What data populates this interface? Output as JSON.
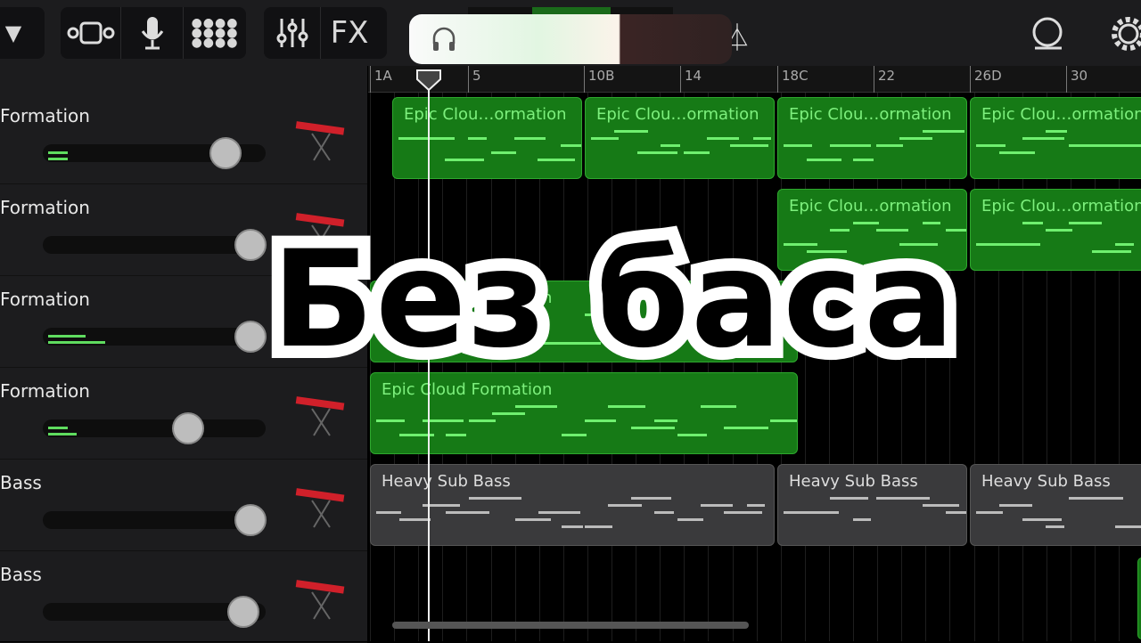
{
  "toolbar": {
    "buttons": [
      {
        "icon": "dropdown-triangle-icon"
      },
      {
        "icon": "tracks-view-icon"
      },
      {
        "icon": "microphone-icon"
      },
      {
        "icon": "grid-icon"
      },
      {
        "icon": "mixer-icon"
      },
      {
        "icon": "FX"
      },
      {
        "icon": "metronome-icon"
      },
      {
        "icon": "loop-icon"
      },
      {
        "icon": "settings-icon"
      }
    ],
    "fx_label": "FX"
  },
  "popup": {
    "icon": "headphones-icon"
  },
  "ruler": {
    "marks": [
      "1A",
      "5",
      "10B",
      "14",
      "18C",
      "22",
      "26D",
      "30"
    ]
  },
  "tracks": [
    {
      "name": "Formation",
      "volume": 0.82
    },
    {
      "name": "Formation",
      "volume": 0.93
    },
    {
      "name": "Formation",
      "volume": 0.93
    },
    {
      "name": "Formation",
      "volume": 0.65
    },
    {
      "name": "Bass",
      "volume": 0.93
    },
    {
      "name": "Bass",
      "volume": 0.9
    }
  ],
  "clips": {
    "row1": [
      "Epic Clou…ormation",
      "Epic Clou…ormation",
      "Epic Clou…ormation",
      "Epic Clou…ormation"
    ],
    "row2": [
      "Epic Clou…ormation",
      "Epic Clou…ormation"
    ],
    "row3": [
      "Epic Cloud Formation"
    ],
    "row4": [
      "Epic Cloud Formation"
    ],
    "row5": [
      "Heavy Sub Bass",
      "Heavy Sub Bass",
      "Heavy Sub Bass"
    ]
  },
  "overlay_text": "Без баса",
  "colors": {
    "region_green": "#167a16",
    "note_green": "#6ff06f",
    "bass_region": "#3a3a3c"
  }
}
